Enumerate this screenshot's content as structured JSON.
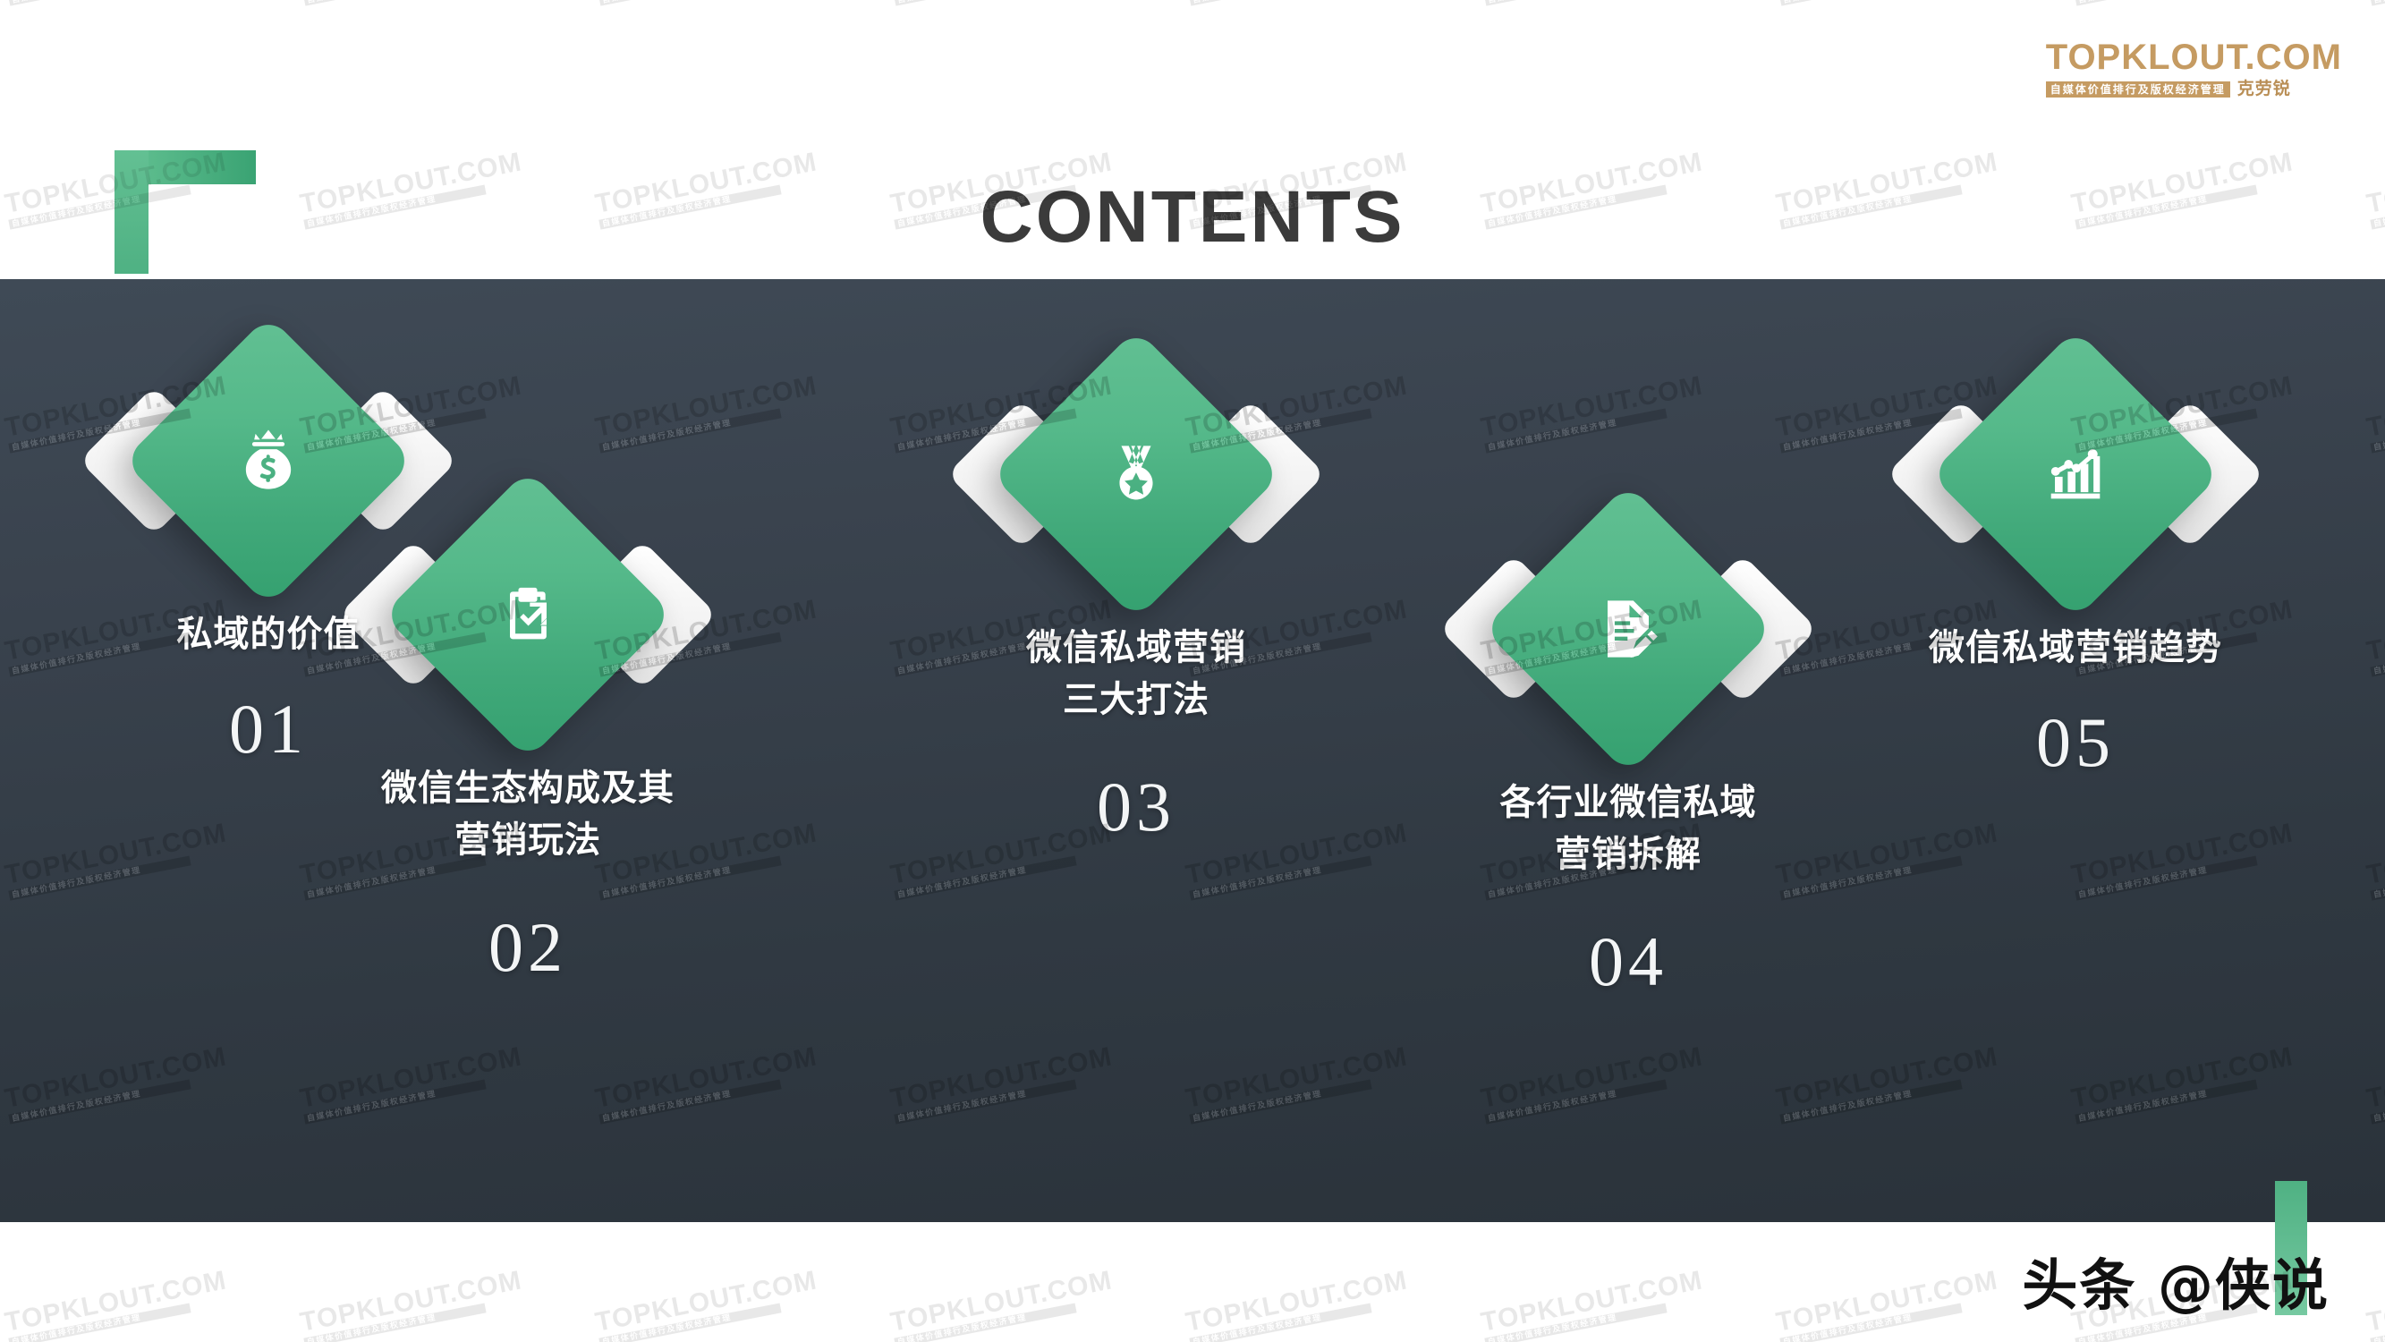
{
  "header": {
    "title": "CONTENTS",
    "corner_mark_color": "#4fb183",
    "logo": {
      "main": "TOPKLOUT.COM",
      "sub": "自媒体价值排行及版权经济管理",
      "cn": "克劳锐",
      "color": "#c59b62"
    }
  },
  "theme": {
    "accent_green": "#4fb183",
    "panel_top": "#3f4a56",
    "panel_bottom": "#2a323a",
    "label_color": "#ffffff",
    "number_color": "#f3f5f6"
  },
  "watermark": {
    "main": "TOPKLOUT.COM",
    "sub": "自媒体价值排行及版权经济管理"
  },
  "items": [
    {
      "number": "01",
      "label_lines": [
        "私域的价值"
      ],
      "icon": "money-bag-icon"
    },
    {
      "number": "02",
      "label_lines": [
        "微信生态构成及其",
        "营销玩法"
      ],
      "icon": "clipboard-check-icon"
    },
    {
      "number": "03",
      "label_lines": [
        "微信私域营销",
        "三大打法"
      ],
      "icon": "medal-star-icon"
    },
    {
      "number": "04",
      "label_lines": [
        "各行业微信私域",
        "营销拆解"
      ],
      "icon": "document-pencil-icon"
    },
    {
      "number": "05",
      "label_lines": [
        "微信私域营销趋势"
      ],
      "icon": "bar-chart-trend-icon"
    }
  ],
  "footer": {
    "brand": "头条 @侠说",
    "bar_color": "#4fb183"
  }
}
